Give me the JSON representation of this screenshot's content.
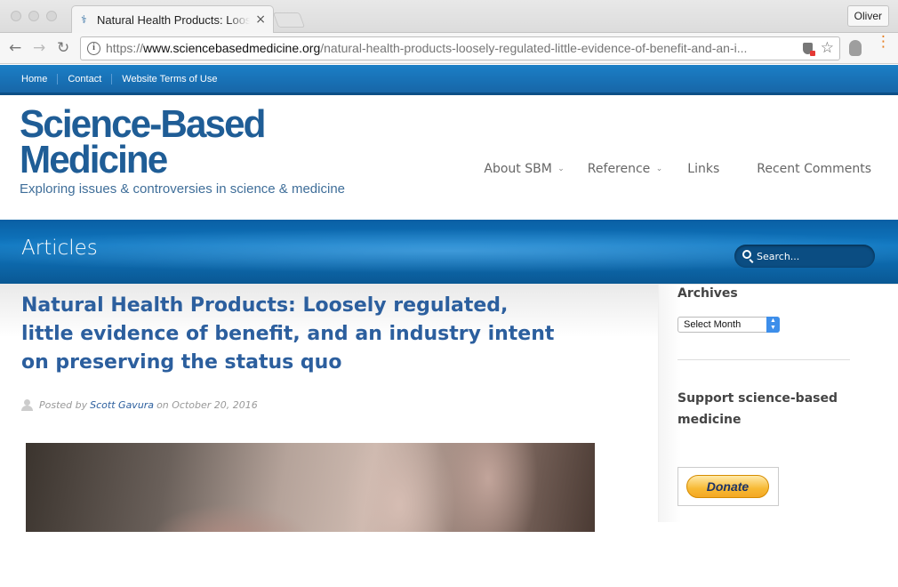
{
  "browser": {
    "tab_title": "Natural Health Products: Loosely regulated, little evidence of benefit, and an industry intent on preserving the status quo",
    "tab_close": "×",
    "profile_name": "Oliver",
    "url_prefix": "https://",
    "url_domain": "www.sciencebasedmedicine.org",
    "url_path": "/natural-health-products-loosely-regulated-little-evidence-of-benefit-and-an-i...",
    "back_glyph": "←",
    "forward_glyph": "→",
    "reload_glyph": "↻",
    "info_glyph": "i",
    "star_glyph": "☆",
    "menu_glyph": "⋮"
  },
  "topnav": {
    "items": [
      "Home",
      "Contact",
      "Website Terms of Use"
    ]
  },
  "header": {
    "logo_line1": "Science-Based",
    "logo_line2": "Medicine",
    "tagline": "Exploring issues & controversies in science & medicine",
    "nav": [
      {
        "label": "About SBM",
        "caret": "⌄"
      },
      {
        "label": "Reference",
        "caret": "⌄"
      },
      {
        "label": "Links"
      },
      {
        "label": "Recent Comments"
      }
    ]
  },
  "titlebar": {
    "title": "Articles",
    "search_placeholder": "Search..."
  },
  "post": {
    "title": "Natural Health Products: Loosely regulated, little evidence of benefit, and an industry intent on preserving the status quo",
    "posted_by": "Posted by",
    "author": "Scott Gavura",
    "on": "on",
    "date": "October 20, 2016"
  },
  "sidebar": {
    "archives_heading": "Archives",
    "archives_select": "Select Month",
    "support_heading": "Support science-based medicine",
    "donate_label": "Donate"
  },
  "colors": {
    "brand_blue": "#1f5d96",
    "link_blue": "#2c5f9e",
    "topbar_blue": "#1766a8"
  }
}
